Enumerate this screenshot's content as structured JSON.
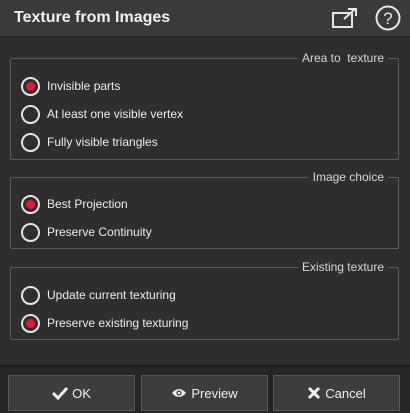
{
  "header": {
    "title": "Texture from Images",
    "icons": [
      "undock-icon",
      "help-icon"
    ]
  },
  "area_group": {
    "legend": "Area to  texture",
    "options": [
      {
        "label": "Invisible parts",
        "checked": true
      },
      {
        "label": "At least one visible vertex",
        "checked": false
      },
      {
        "label": "Fully visible triangles",
        "checked": false
      }
    ]
  },
  "image_group": {
    "legend": "Image choice",
    "options": [
      {
        "label": "Best Projection",
        "checked": true
      },
      {
        "label": "Preserve Continuity",
        "checked": false
      }
    ]
  },
  "existing_group": {
    "legend": "Existing texture",
    "options": [
      {
        "label": "Update current texturing",
        "checked": false
      },
      {
        "label": "Preserve existing texturing",
        "checked": true
      }
    ]
  },
  "footer": {
    "ok_label": "OK",
    "preview_label": "Preview",
    "cancel_label": "Cancel"
  },
  "colors": {
    "accent": "#e8123c",
    "background": "#2e2e2e",
    "header": "#3a3a3a"
  }
}
